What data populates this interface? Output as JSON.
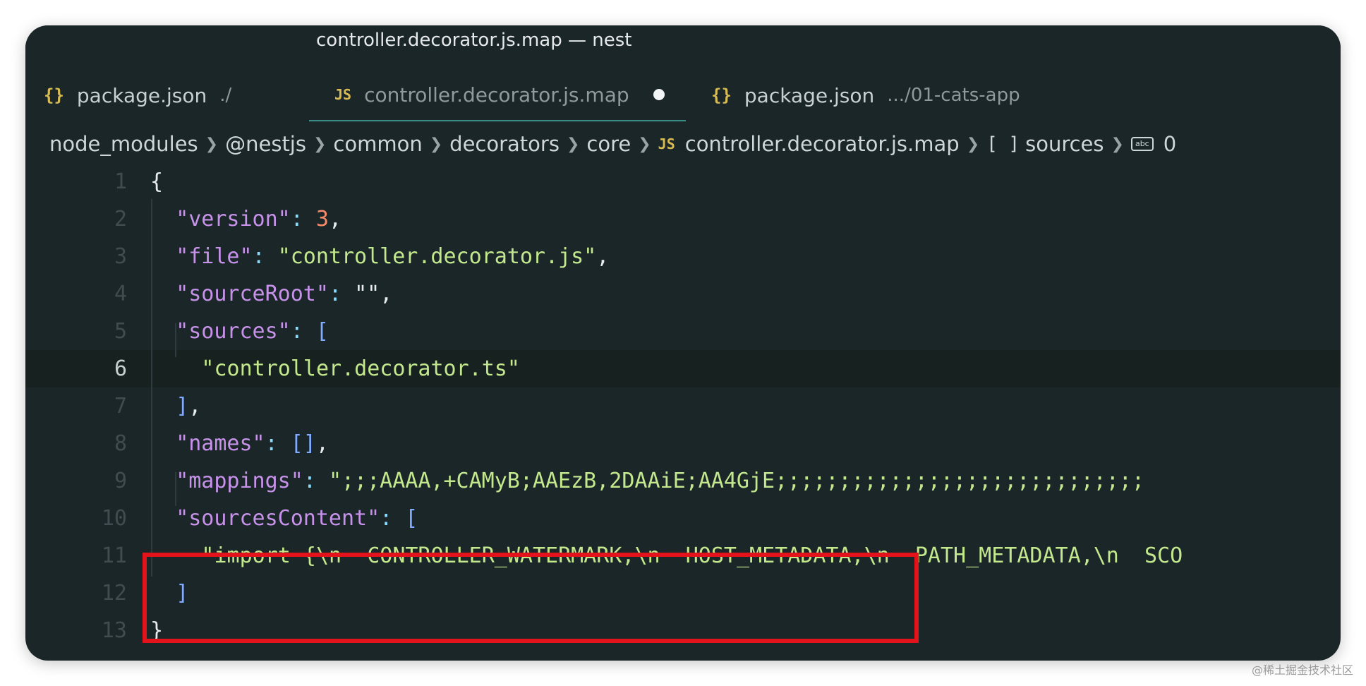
{
  "window": {
    "title": "controller.decorator.js.map — nest"
  },
  "tabs": [
    {
      "icon": "{}",
      "label": "package.json",
      "description": "./"
    },
    {
      "icon": "JS",
      "label": "controller.decorator.js.map",
      "description": ""
    },
    {
      "icon": "{}",
      "label": "package.json",
      "description": ".../01-cats-app"
    }
  ],
  "breadcrumbs": {
    "items": [
      "node_modules",
      "@nestjs",
      "common",
      "decorators",
      "core",
      "controller.decorator.js.map",
      "sources",
      "0"
    ],
    "file_icon": "JS",
    "array_icon": "[ ]",
    "string_icon": "abc"
  },
  "editor": {
    "lines": [
      {
        "n": "1",
        "tokens": [
          {
            "t": "{",
            "c": "pun"
          }
        ]
      },
      {
        "n": "2",
        "tokens": [
          {
            "t": "\"version\"",
            "c": "key"
          },
          {
            "t": ": ",
            "c": "colon"
          },
          {
            "t": "3",
            "c": "num"
          },
          {
            "t": ",",
            "c": "pun"
          }
        ]
      },
      {
        "n": "3",
        "tokens": [
          {
            "t": "\"file\"",
            "c": "key"
          },
          {
            "t": ": ",
            "c": "colon"
          },
          {
            "t": "\"controller.decorator.js\"",
            "c": "str"
          },
          {
            "t": ",",
            "c": "pun"
          }
        ]
      },
      {
        "n": "4",
        "tokens": [
          {
            "t": "\"sourceRoot\"",
            "c": "key"
          },
          {
            "t": ": ",
            "c": "colon"
          },
          {
            "t": "\"\"",
            "c": "pun"
          },
          {
            "t": ",",
            "c": "pun"
          }
        ]
      },
      {
        "n": "5",
        "tokens": [
          {
            "t": "\"sources\"",
            "c": "key"
          },
          {
            "t": ": ",
            "c": "colon"
          },
          {
            "t": "[",
            "c": "brk"
          }
        ]
      },
      {
        "n": "6",
        "tokens": [
          {
            "t": "\"controller.decorator.ts\"",
            "c": "str"
          }
        ]
      },
      {
        "n": "7",
        "tokens": [
          {
            "t": "]",
            "c": "brk"
          },
          {
            "t": ",",
            "c": "pun"
          }
        ]
      },
      {
        "n": "8",
        "tokens": [
          {
            "t": "\"names\"",
            "c": "key"
          },
          {
            "t": ": ",
            "c": "colon"
          },
          {
            "t": "[]",
            "c": "brk"
          },
          {
            "t": ",",
            "c": "pun"
          }
        ]
      },
      {
        "n": "9",
        "tokens": [
          {
            "t": "\"mappings\"",
            "c": "key"
          },
          {
            "t": ": ",
            "c": "colon"
          },
          {
            "t": "\";;;AAAA,+CAMyB;AAEzB,2DAAiE;AA4GjE;;;;;;;;;;;;;;;;;;;;;;;;;;;;;",
            "c": "str"
          }
        ]
      },
      {
        "n": "10",
        "tokens": [
          {
            "t": "\"sourcesContent\"",
            "c": "key"
          },
          {
            "t": ": ",
            "c": "colon"
          },
          {
            "t": "[",
            "c": "brk"
          }
        ]
      },
      {
        "n": "11",
        "tokens": [
          {
            "t": "\"import {\\n  CONTROLLER_WATERMARK,\\n  HOST_METADATA,\\n  PATH_METADATA,\\n  SCO",
            "c": "str"
          }
        ]
      },
      {
        "n": "12",
        "tokens": [
          {
            "t": "]",
            "c": "brk"
          }
        ]
      },
      {
        "n": "13",
        "tokens": [
          {
            "t": "}",
            "c": "pun"
          }
        ]
      }
    ],
    "current_line": "6"
  },
  "watermark": "@稀土掘金技术社区",
  "colors": {
    "background": "#1b2628",
    "highlight_box": "#e3131b",
    "key": "#c792ea",
    "string": "#c3e88d",
    "number": "#f78c6c",
    "bracket": "#82aaff"
  }
}
